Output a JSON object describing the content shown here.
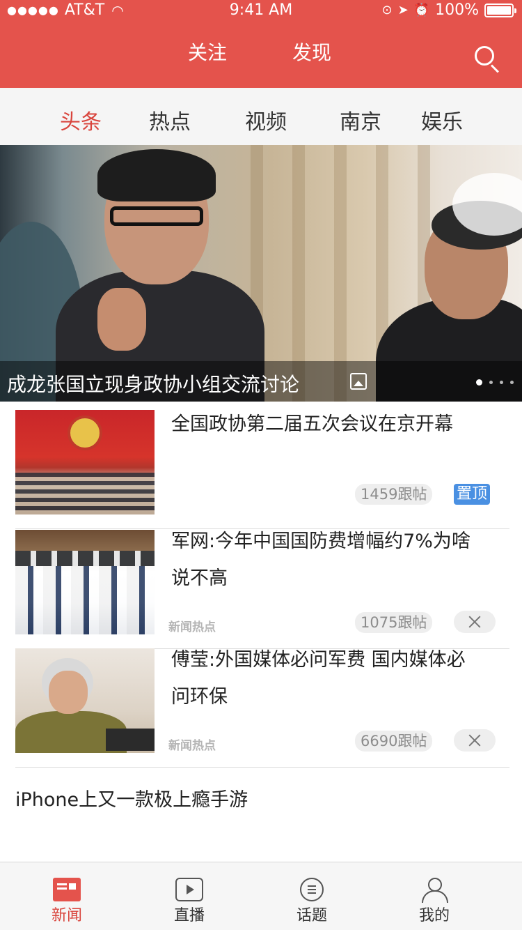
{
  "status_bar": {
    "signal": "●●●●●",
    "carrier": "AT&T",
    "time": "9:41 AM",
    "battery": "100%"
  },
  "header": {
    "tabs": [
      "关注",
      "发现"
    ]
  },
  "categories": [
    "头条",
    "热点",
    "视频",
    "南京",
    "娱乐"
  ],
  "hero": {
    "caption": "成龙张国立现身政协小组交流讨论",
    "slide_count": 4,
    "active_slide": 1
  },
  "news": [
    {
      "title": "全国政协第二届五次会议在京开幕",
      "comments": "1459跟帖",
      "badge": "置顶",
      "source_tag": ""
    },
    {
      "title": "军网:今年中国国防费增幅约7%为啥说不高",
      "comments": "1075跟帖",
      "badge": "",
      "source_tag": "新闻热点"
    },
    {
      "title": "傅莹:外国媒体必问军费 国内媒体必问环保",
      "comments": "6690跟帖",
      "badge": "",
      "source_tag": "新闻热点"
    }
  ],
  "plain_item": {
    "title": "iPhone上又一款极上瘾手游"
  },
  "tabbar": {
    "items": [
      "新闻",
      "直播",
      "话题",
      "我的"
    ],
    "active": "新闻"
  },
  "colors": {
    "brand_red": "#e4534c",
    "active_text": "#d9443c",
    "pin_blue": "#4a90e2"
  }
}
